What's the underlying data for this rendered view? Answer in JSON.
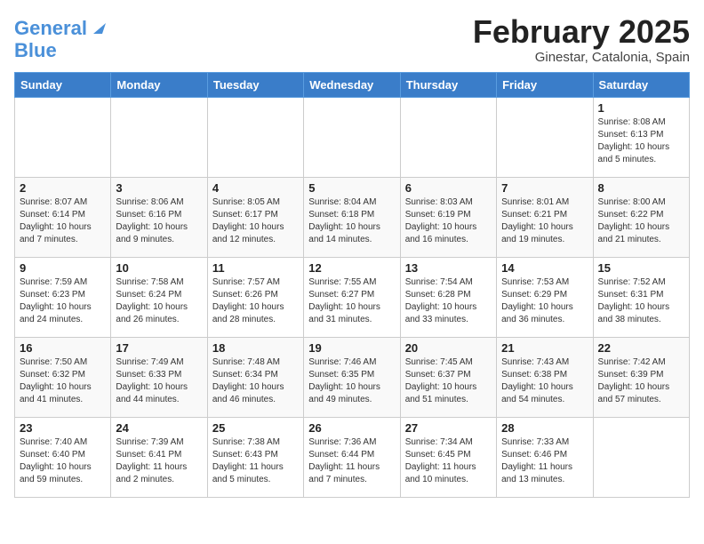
{
  "header": {
    "logo_line1": "General",
    "logo_line2": "Blue",
    "month_title": "February 2025",
    "location": "Ginestar, Catalonia, Spain"
  },
  "weekdays": [
    "Sunday",
    "Monday",
    "Tuesday",
    "Wednesday",
    "Thursday",
    "Friday",
    "Saturday"
  ],
  "weeks": [
    [
      {
        "day": "",
        "info": ""
      },
      {
        "day": "",
        "info": ""
      },
      {
        "day": "",
        "info": ""
      },
      {
        "day": "",
        "info": ""
      },
      {
        "day": "",
        "info": ""
      },
      {
        "day": "",
        "info": ""
      },
      {
        "day": "1",
        "info": "Sunrise: 8:08 AM\nSunset: 6:13 PM\nDaylight: 10 hours\nand 5 minutes."
      }
    ],
    [
      {
        "day": "2",
        "info": "Sunrise: 8:07 AM\nSunset: 6:14 PM\nDaylight: 10 hours\nand 7 minutes."
      },
      {
        "day": "3",
        "info": "Sunrise: 8:06 AM\nSunset: 6:16 PM\nDaylight: 10 hours\nand 9 minutes."
      },
      {
        "day": "4",
        "info": "Sunrise: 8:05 AM\nSunset: 6:17 PM\nDaylight: 10 hours\nand 12 minutes."
      },
      {
        "day": "5",
        "info": "Sunrise: 8:04 AM\nSunset: 6:18 PM\nDaylight: 10 hours\nand 14 minutes."
      },
      {
        "day": "6",
        "info": "Sunrise: 8:03 AM\nSunset: 6:19 PM\nDaylight: 10 hours\nand 16 minutes."
      },
      {
        "day": "7",
        "info": "Sunrise: 8:01 AM\nSunset: 6:21 PM\nDaylight: 10 hours\nand 19 minutes."
      },
      {
        "day": "8",
        "info": "Sunrise: 8:00 AM\nSunset: 6:22 PM\nDaylight: 10 hours\nand 21 minutes."
      }
    ],
    [
      {
        "day": "9",
        "info": "Sunrise: 7:59 AM\nSunset: 6:23 PM\nDaylight: 10 hours\nand 24 minutes."
      },
      {
        "day": "10",
        "info": "Sunrise: 7:58 AM\nSunset: 6:24 PM\nDaylight: 10 hours\nand 26 minutes."
      },
      {
        "day": "11",
        "info": "Sunrise: 7:57 AM\nSunset: 6:26 PM\nDaylight: 10 hours\nand 28 minutes."
      },
      {
        "day": "12",
        "info": "Sunrise: 7:55 AM\nSunset: 6:27 PM\nDaylight: 10 hours\nand 31 minutes."
      },
      {
        "day": "13",
        "info": "Sunrise: 7:54 AM\nSunset: 6:28 PM\nDaylight: 10 hours\nand 33 minutes."
      },
      {
        "day": "14",
        "info": "Sunrise: 7:53 AM\nSunset: 6:29 PM\nDaylight: 10 hours\nand 36 minutes."
      },
      {
        "day": "15",
        "info": "Sunrise: 7:52 AM\nSunset: 6:31 PM\nDaylight: 10 hours\nand 38 minutes."
      }
    ],
    [
      {
        "day": "16",
        "info": "Sunrise: 7:50 AM\nSunset: 6:32 PM\nDaylight: 10 hours\nand 41 minutes."
      },
      {
        "day": "17",
        "info": "Sunrise: 7:49 AM\nSunset: 6:33 PM\nDaylight: 10 hours\nand 44 minutes."
      },
      {
        "day": "18",
        "info": "Sunrise: 7:48 AM\nSunset: 6:34 PM\nDaylight: 10 hours\nand 46 minutes."
      },
      {
        "day": "19",
        "info": "Sunrise: 7:46 AM\nSunset: 6:35 PM\nDaylight: 10 hours\nand 49 minutes."
      },
      {
        "day": "20",
        "info": "Sunrise: 7:45 AM\nSunset: 6:37 PM\nDaylight: 10 hours\nand 51 minutes."
      },
      {
        "day": "21",
        "info": "Sunrise: 7:43 AM\nSunset: 6:38 PM\nDaylight: 10 hours\nand 54 minutes."
      },
      {
        "day": "22",
        "info": "Sunrise: 7:42 AM\nSunset: 6:39 PM\nDaylight: 10 hours\nand 57 minutes."
      }
    ],
    [
      {
        "day": "23",
        "info": "Sunrise: 7:40 AM\nSunset: 6:40 PM\nDaylight: 10 hours\nand 59 minutes."
      },
      {
        "day": "24",
        "info": "Sunrise: 7:39 AM\nSunset: 6:41 PM\nDaylight: 11 hours\nand 2 minutes."
      },
      {
        "day": "25",
        "info": "Sunrise: 7:38 AM\nSunset: 6:43 PM\nDaylight: 11 hours\nand 5 minutes."
      },
      {
        "day": "26",
        "info": "Sunrise: 7:36 AM\nSunset: 6:44 PM\nDaylight: 11 hours\nand 7 minutes."
      },
      {
        "day": "27",
        "info": "Sunrise: 7:34 AM\nSunset: 6:45 PM\nDaylight: 11 hours\nand 10 minutes."
      },
      {
        "day": "28",
        "info": "Sunrise: 7:33 AM\nSunset: 6:46 PM\nDaylight: 11 hours\nand 13 minutes."
      },
      {
        "day": "",
        "info": ""
      }
    ]
  ]
}
